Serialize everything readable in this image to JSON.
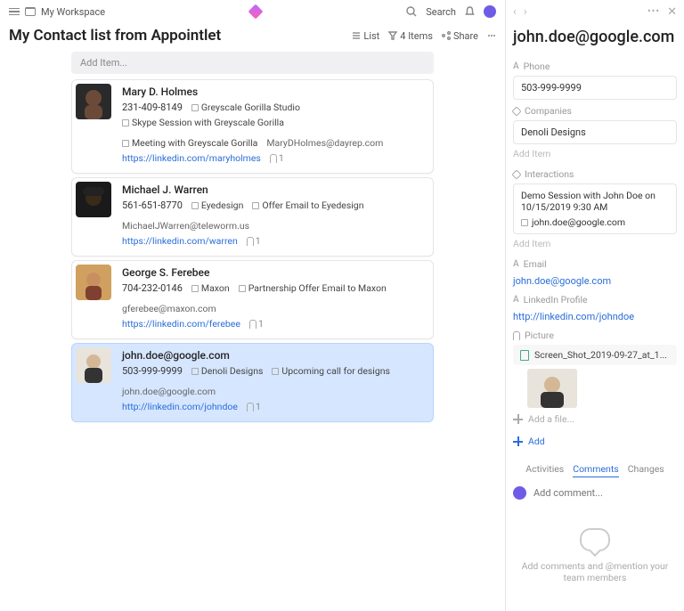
{
  "topbar": {
    "workspace": "My Workspace",
    "search": "Search"
  },
  "page": {
    "title": "My Contact list from Appointlet"
  },
  "toolbar": {
    "list": "List",
    "items": "4 Items",
    "share": "Share"
  },
  "add_item_placeholder": "Add Item...",
  "contacts": [
    {
      "name": "Mary D. Holmes",
      "phone": "231-409-8149",
      "chips": [
        "Greyscale Gorilla Studio"
      ],
      "chips2": [
        "Skype Session with Greyscale Gorilla",
        "Meeting with Greyscale Gorilla"
      ],
      "email": "MaryDHolmes@dayrep.com",
      "linkedin": "https://linkedin.com/maryholmes",
      "attach": "1"
    },
    {
      "name": "Michael J. Warren",
      "phone": "561-651-8770",
      "chips": [
        "Eyedesign"
      ],
      "chips2": [
        "Offer Email to Eyedesign"
      ],
      "email": "MichaelJWarren@teleworm.us",
      "linkedin": "https://linkedin.com/warren",
      "attach": "1"
    },
    {
      "name": "George S. Ferebee",
      "phone": "704-232-0146",
      "chips": [
        "Maxon"
      ],
      "chips2": [
        "Partnership Offer Email to Maxon"
      ],
      "email": "gferebee@maxon.com",
      "linkedin": "https://linkedin.com/ferebee",
      "attach": "1"
    },
    {
      "name": "john.doe@google.com",
      "phone": "503-999-9999",
      "chips": [
        "Denoli Designs"
      ],
      "chips2": [
        "Upcoming call for designs"
      ],
      "email": "john.doe@google.com",
      "linkedin": "http://linkedin.com/johndoe",
      "attach": "1"
    }
  ],
  "detail": {
    "title": "john.doe@google.com",
    "labels": {
      "phone": "Phone",
      "companies": "Companies",
      "interactions": "Interactions",
      "email": "Email",
      "linkedin": "LinkedIn Profile",
      "picture": "Picture",
      "add_item": "Add Item",
      "add_file": "Add a file...",
      "add": "Add"
    },
    "phone": "503-999-9999",
    "company": "Denoli Designs",
    "interaction_title": "Demo Session with John Doe on 10/15/2019 9:30 AM",
    "interaction_sub": "john.doe@google.com",
    "email": "john.doe@google.com",
    "linkedin": "http://linkedin.com/johndoe",
    "filename": "Screen_Shot_2019-09-27_at_1...",
    "tabs": {
      "activities": "Activities",
      "comments": "Comments",
      "changes": "Changes"
    },
    "comment_placeholder": "Add comment...",
    "empty": "Add comments and @mention your team members"
  }
}
